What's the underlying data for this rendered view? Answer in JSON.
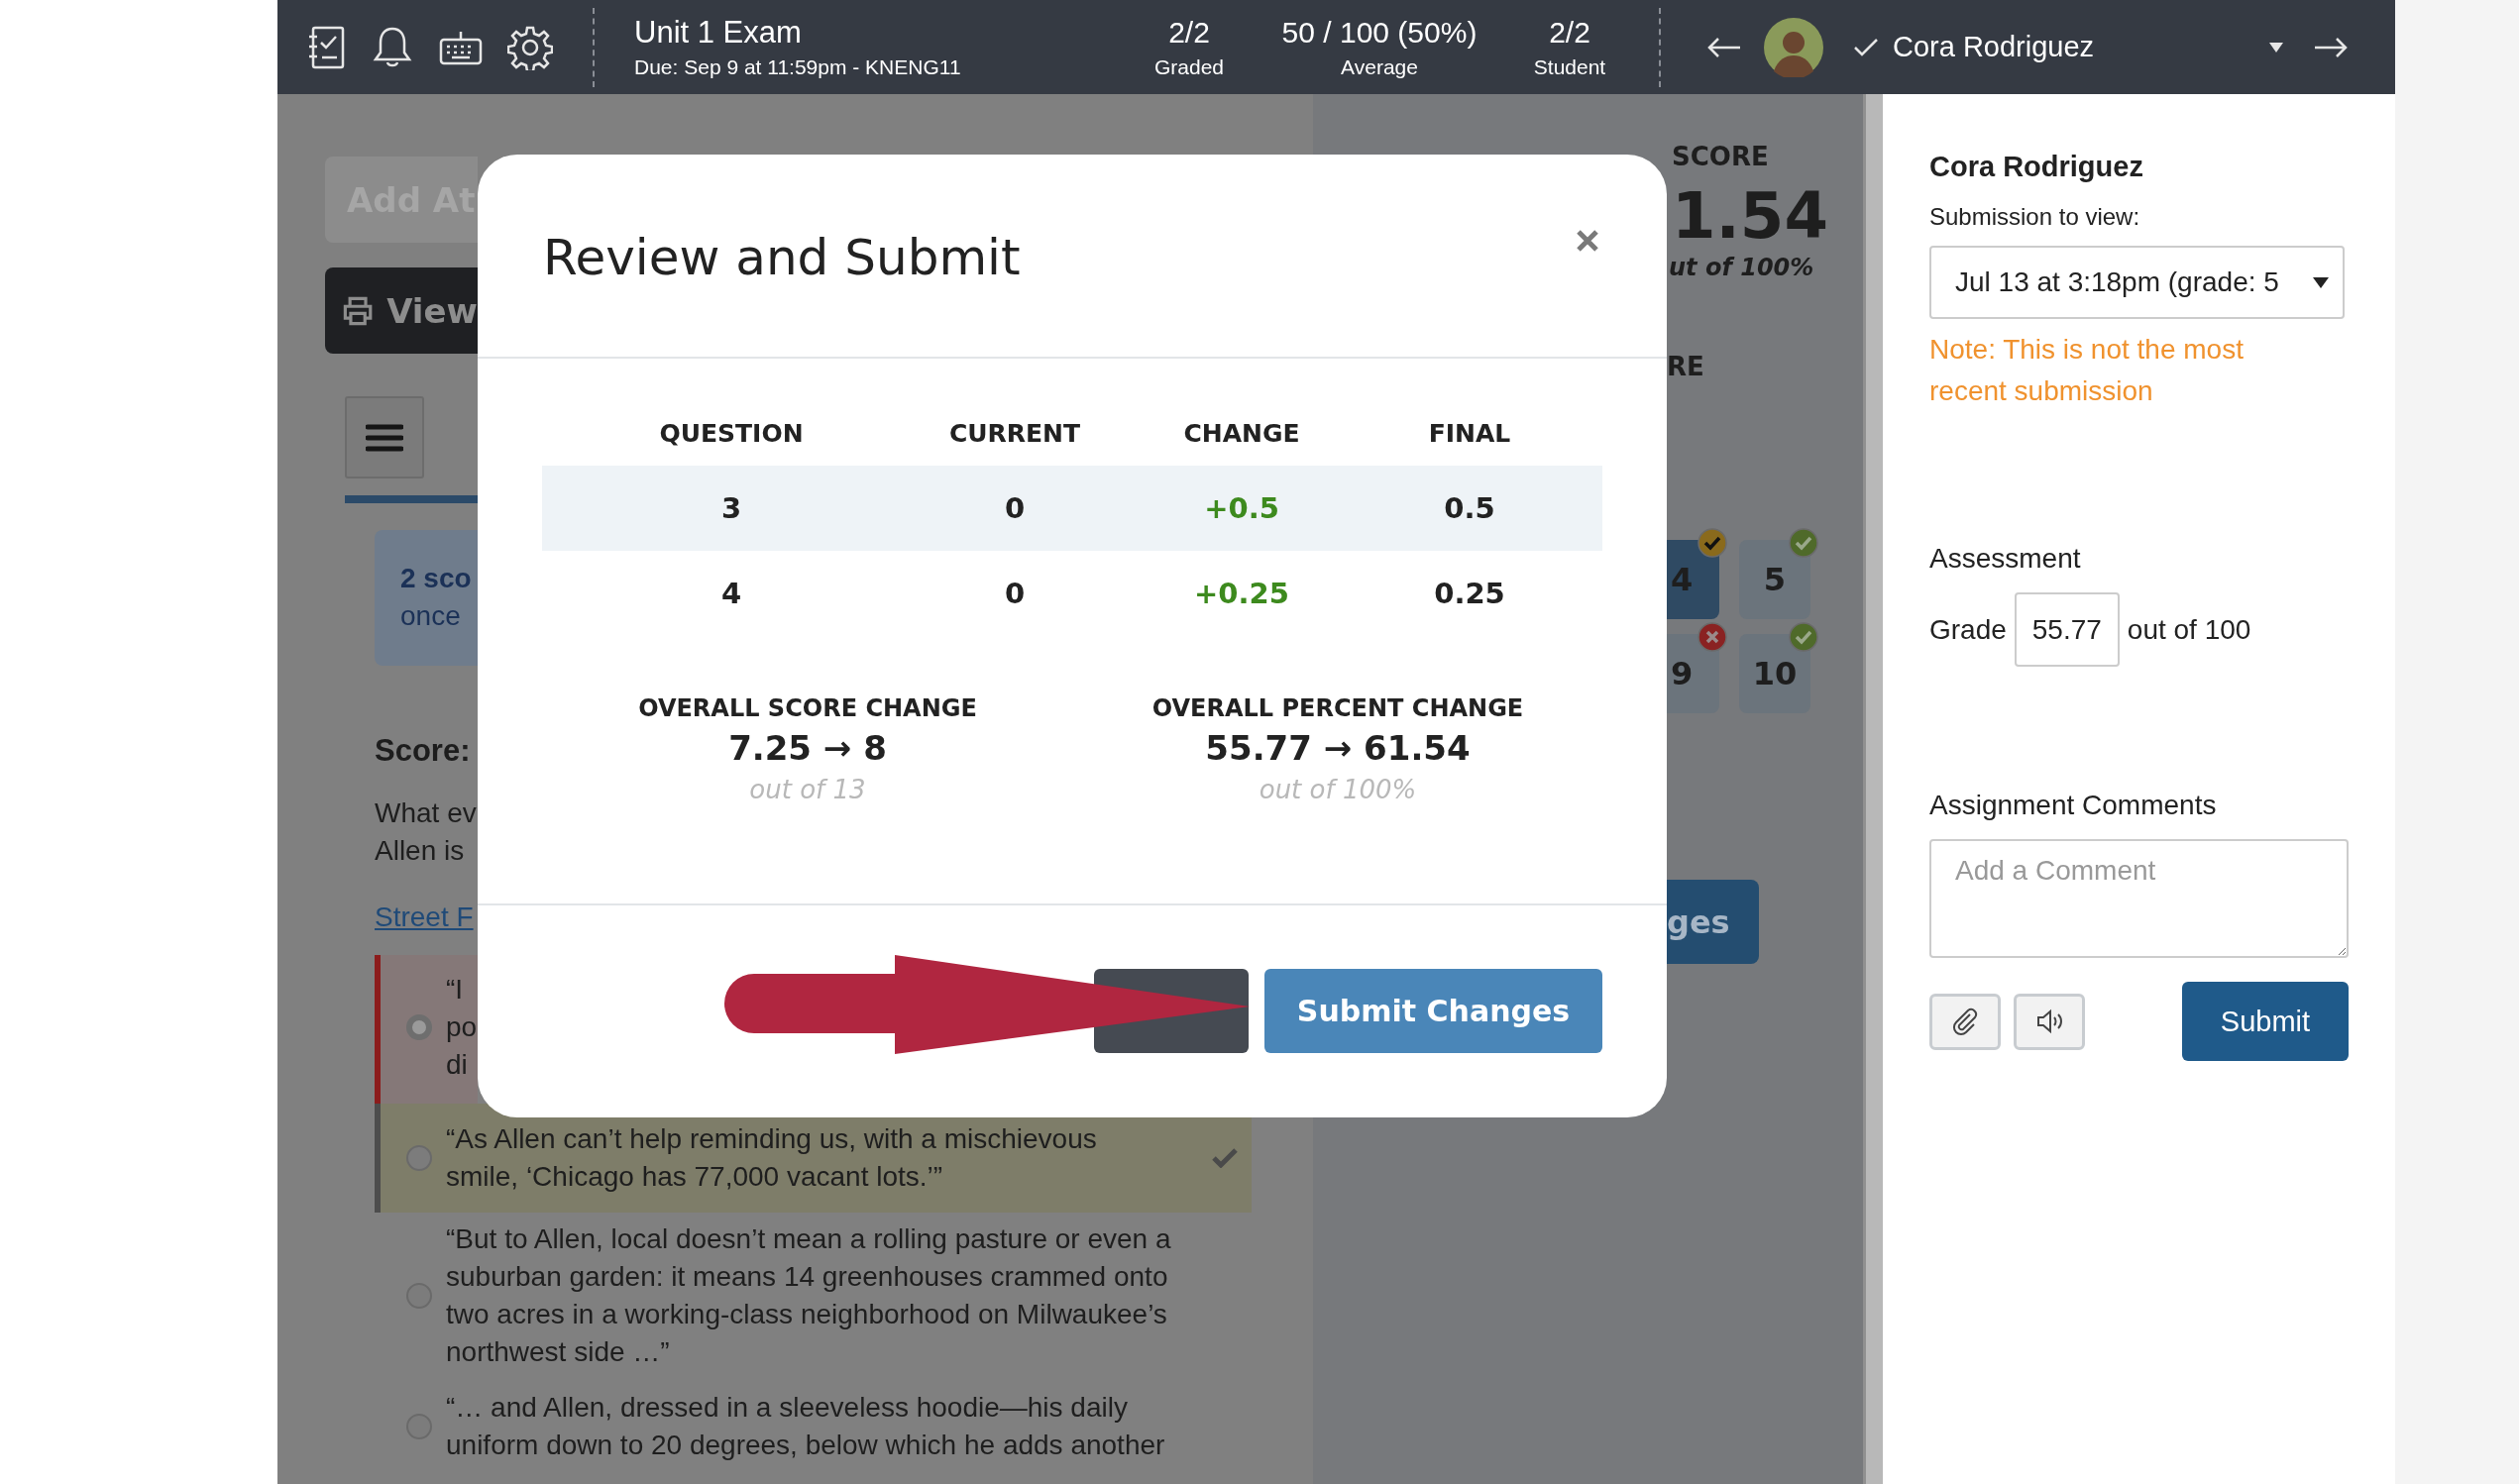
{
  "top_bar": {
    "title": "Unit 1 Exam",
    "due": "Due: Sep 9 at 11:59pm - KNENG11",
    "stats": [
      {
        "value": "2/2",
        "label": "Graded"
      },
      {
        "value": "50 / 100 (50%)",
        "label": "Average"
      },
      {
        "value": "2/2",
        "label": "Student"
      }
    ],
    "student": {
      "name": "Cora Rodriguez",
      "checked": true
    }
  },
  "background": {
    "add_button": "Add At",
    "view_button": "View",
    "info": [
      "2 sco",
      "once"
    ],
    "score_label": "Score:",
    "question": "What ev\nAllen is",
    "link": "Street F",
    "answers": [
      {
        "kind": "incorrect",
        "selected": true,
        "text": "“I\npo\ndi"
      },
      {
        "kind": "correct",
        "selected": false,
        "text": "“As Allen can’t help reminding us, with a mischievous\nsmile, ‘Chicago has 77,000 vacant lots.’”"
      },
      {
        "kind": "plain",
        "selected": false,
        "text": "“But to Allen, local doesn’t mean a rolling pasture or even a\nsuburban garden: it means 14 greenhouses crammed onto\ntwo acres in a working-class neighborhood on Milwaukee’s\nnorthwest side …”"
      },
      {
        "kind": "plain",
        "selected": false,
        "text": "“… and Allen, dressed in a sleeveless hoodie—his daily\nuniform down to 20 degrees, below which he adds another"
      }
    ],
    "score_heading": "SCORE",
    "score": "1.54",
    "score_note": "ut of 100%",
    "heading_2": "RE",
    "tiles": [
      {
        "label": "4",
        "kind": "partial",
        "selected": true
      },
      {
        "label": "5",
        "kind": "correct",
        "selected": false
      },
      {
        "label": "9",
        "kind": "incorrect",
        "selected": false
      },
      {
        "label": "10",
        "kind": "correct",
        "selected": false
      }
    ],
    "save_button": "ges"
  },
  "modal": {
    "title": "Review and Submit",
    "columns": [
      {
        "label": "QUESTION",
        "kind": "plain"
      },
      {
        "label": "CURRENT",
        "kind": "plain"
      },
      {
        "label": "CHANGE",
        "kind": "change"
      },
      {
        "label": "FINAL",
        "kind": "plain"
      }
    ],
    "rows": [
      {
        "highlighted": true,
        "cells": [
          "3",
          "0",
          "+0.5",
          "0.5"
        ]
      },
      {
        "highlighted": false,
        "cells": [
          "4",
          "0",
          "+0.25",
          "0.25"
        ]
      }
    ],
    "summary": [
      {
        "label": "OVERALL SCORE CHANGE",
        "value": "7.25 → 8",
        "note": "out of 13"
      },
      {
        "label": "OVERALL PERCENT CHANGE",
        "value": "55.77 → 61.54",
        "note": "out of 100%"
      }
    ],
    "buttons": [
      {
        "kind": "secondary"
      },
      {
        "kind": "primary",
        "label": "Submit Changes"
      }
    ]
  },
  "right_panel": {
    "student_name": "Cora Rodriguez",
    "submission_label": "Submission to view:",
    "submission_value": "Jul 13 at 3:18pm (grade: 5",
    "note": "Note: This is not the most\nrecent submission",
    "assessment_heading": "Assessment",
    "grade_label": "Grade",
    "grade_value": "55.77",
    "grade_suffix": "out of 100",
    "comments_heading": "Assignment Comments",
    "comment_placeholder": "Add a Comment",
    "submit": "Submit"
  }
}
